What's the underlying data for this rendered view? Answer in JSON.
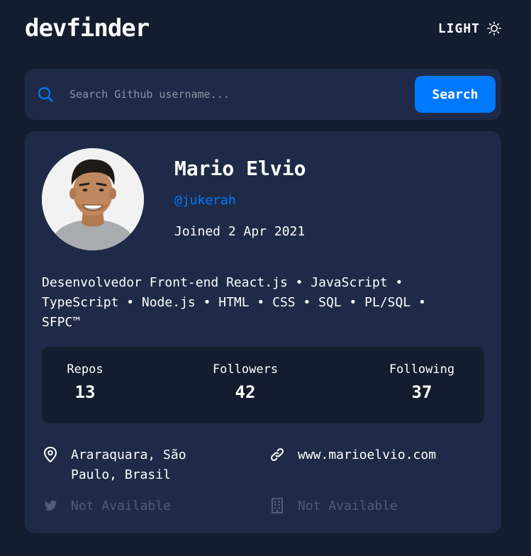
{
  "header": {
    "app_title": "devfinder",
    "theme_label": "LIGHT",
    "theme_icon": "sun-icon"
  },
  "search": {
    "placeholder": "Search Github username...",
    "value": "",
    "button_label": "Search",
    "icon": "search-icon"
  },
  "profile": {
    "name": "Mario Elvio",
    "login": "@jukerah",
    "joined": "Joined 2 Apr 2021",
    "bio_line1": "Desenvolvedor Front-end React.js • JavaScript •",
    "bio_line2": "TypeScript • Node.js • HTML • CSS • SQL • PL/SQL •",
    "bio_line3": "SFPC™",
    "stats": {
      "repos_label": "Repos",
      "repos_value": "13",
      "followers_label": "Followers",
      "followers_value": "42",
      "following_label": "Following",
      "following_value": "37"
    },
    "links": {
      "location_line1": "Araraquara, São",
      "location_line2": "Paulo, Brasil",
      "website": "www.marioelvio.com",
      "twitter": "Not Available",
      "company": "Not Available"
    }
  },
  "colors": {
    "background": "#141D2F",
    "card": "#1E2A47",
    "accent": "#0079FF",
    "muted": "#4F5D78"
  }
}
